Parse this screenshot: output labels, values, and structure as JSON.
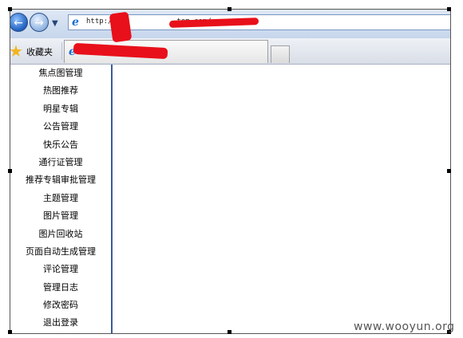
{
  "browser": {
    "back_icon": "back-arrow-icon",
    "forward_icon": "forward-arrow-icon",
    "address_prefix": "http://",
    "address_domain": ".tom.com/",
    "favorites_label": "收藏夹",
    "tab_title": ""
  },
  "sidebar": {
    "items": [
      {
        "label": "焦点图管理"
      },
      {
        "label": "热图推荐"
      },
      {
        "label": "明星专辑"
      },
      {
        "label": "公告管理"
      },
      {
        "label": "快乐公告"
      },
      {
        "label": "通行证管理"
      },
      {
        "label": "推荐专辑审批管理"
      },
      {
        "label": "主题管理"
      },
      {
        "label": "图片管理"
      },
      {
        "label": "图片回收站"
      },
      {
        "label": "页面自动生成管理"
      },
      {
        "label": "评论管理"
      },
      {
        "label": "管理日志"
      },
      {
        "label": "修改密码"
      },
      {
        "label": "退出登录"
      }
    ]
  },
  "watermark": "www.wooyun.org",
  "colors": {
    "redaction": "#e8101a",
    "sidebar_divider": "#3b5b9a"
  }
}
